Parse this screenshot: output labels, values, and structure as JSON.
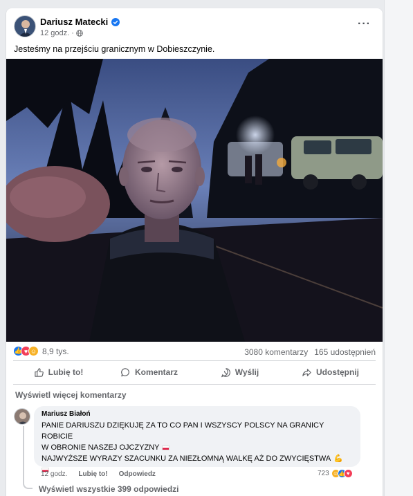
{
  "post": {
    "author": "Dariusz Matecki",
    "time": "12 godz.",
    "separator": "·",
    "text": "Jesteśmy na przejściu granicznym w Dobieszczynie."
  },
  "stats": {
    "reaction_count": "8,9 tys.",
    "comments": "3080 komentarzy",
    "shares": "165 udostępnień"
  },
  "actions": {
    "like": "Lubię to!",
    "comment": "Komentarz",
    "send": "Wyślij",
    "share": "Udostępnij"
  },
  "comments_section": {
    "view_more": "Wyświetl więcej komentarzy",
    "comment": {
      "author": "Mariusz Białoń",
      "line1": "PANIE DARIUSZU DZIĘKUJĘ ZA TO CO PAN I WSZYSCY POLSCY NA GRANICY ROBICIE",
      "line2": "W OBRONIE NASZEJ OJCZYZNY",
      "line3": "NAJWYŻSZE WYRAZY SZACUNKU ZA NIEZŁOMNĄ WALKĘ AŻ DO ZWYCIĘSTWA",
      "time": "12 godz.",
      "like": "Lubię to!",
      "reply": "Odpowiedz",
      "reaction_count": "723"
    },
    "view_replies": "Wyświetl wszystkie 399 odpowiedzi"
  },
  "icons": {
    "verified": "verified-badge-icon",
    "globe": "globe-icon",
    "more": "more-options-icon",
    "like": "thumbs-up-icon",
    "comment": "speech-bubble-icon",
    "send": "whatsapp-icon",
    "share": "share-arrow-icon"
  },
  "colors": {
    "like_blue": "#1877f2",
    "love_red": "#f33e58",
    "haha_yellow": "#f7b125",
    "verified_blue": "#1877f2",
    "muted_text": "#65676b"
  }
}
